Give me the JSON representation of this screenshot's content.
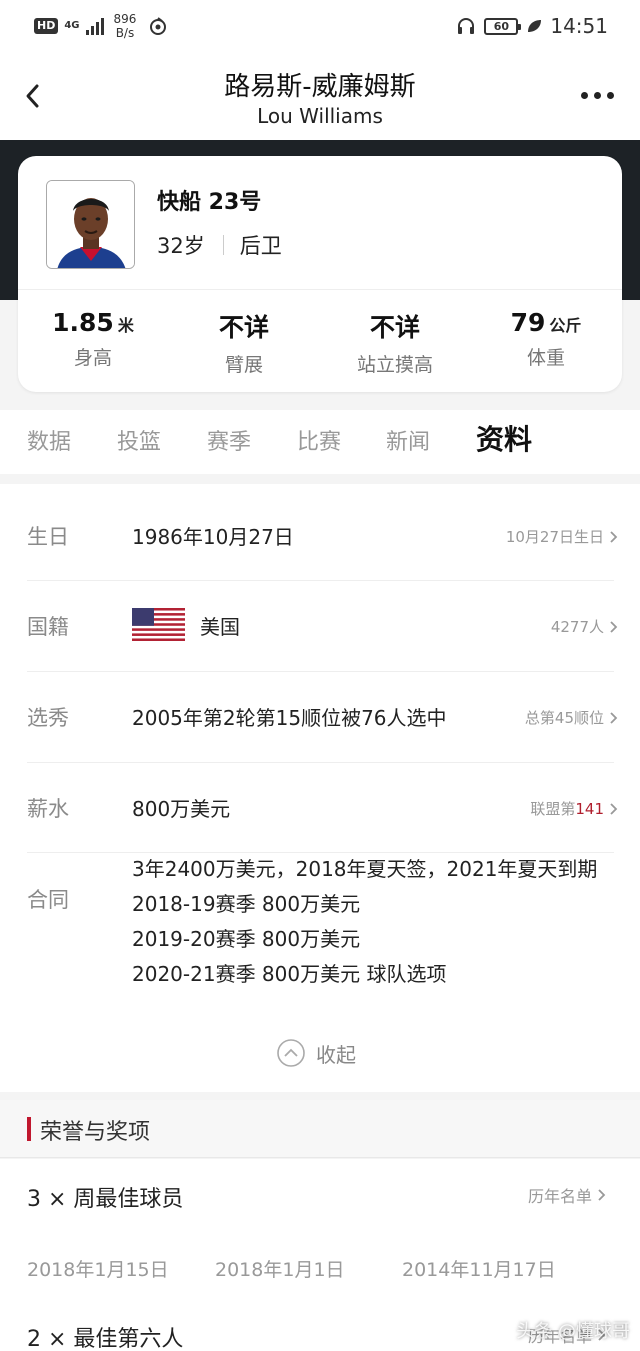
{
  "status": {
    "hd": "HD",
    "network": "4G",
    "speed_value": "896",
    "speed_unit": "B/s",
    "battery": "60",
    "time": "14:51"
  },
  "header": {
    "title_cn": "路易斯-威廉姆斯",
    "title_en": "Lou Williams"
  },
  "player": {
    "team_number": "快船 23号",
    "age": "32岁",
    "position": "后卫",
    "measurements": [
      {
        "value": "1.85",
        "unit": "米",
        "label": "身高"
      },
      {
        "value": "不详",
        "unit": "",
        "label": "臂展"
      },
      {
        "value": "不详",
        "unit": "",
        "label": "站立摸高"
      },
      {
        "value": "79",
        "unit": "公斤",
        "label": "体重"
      }
    ]
  },
  "tabs": [
    "数据",
    "投篮",
    "赛季",
    "比赛",
    "新闻",
    "资料"
  ],
  "active_tab": "资料",
  "info": {
    "birthday": {
      "label": "生日",
      "value": "1986年10月27日",
      "link": "10月27日生日"
    },
    "nationality": {
      "label": "国籍",
      "value": "美国",
      "link": "4277人"
    },
    "draft": {
      "label": "选秀",
      "value": "2005年第2轮第15顺位被76人选中",
      "link": "总第45顺位"
    },
    "salary": {
      "label": "薪水",
      "value": "800万美元",
      "link_prefix": "联盟第",
      "link_rank": "141"
    },
    "contract": {
      "label": "合同",
      "lines": [
        "3年2400万美元，2018年夏天签，2021年夏天到期",
        "2018-19赛季 800万美元",
        "2019-20赛季 800万美元",
        "2020-21赛季 800万美元 球队选项"
      ]
    },
    "collapse_label": "收起"
  },
  "honors": {
    "title": "荣誉与奖项",
    "awards": [
      {
        "name": "3 × 周最佳球员",
        "link": "历年名单",
        "dates": [
          "2018年1月15日",
          "2018年1月1日",
          "2014年11月17日"
        ]
      },
      {
        "name": "2 × 最佳第六人",
        "link": "历年名单"
      }
    ]
  },
  "watermark": "头条 @懂球哥",
  "colors": {
    "accent": "#c0172e",
    "dark_band": "#1d2226"
  }
}
